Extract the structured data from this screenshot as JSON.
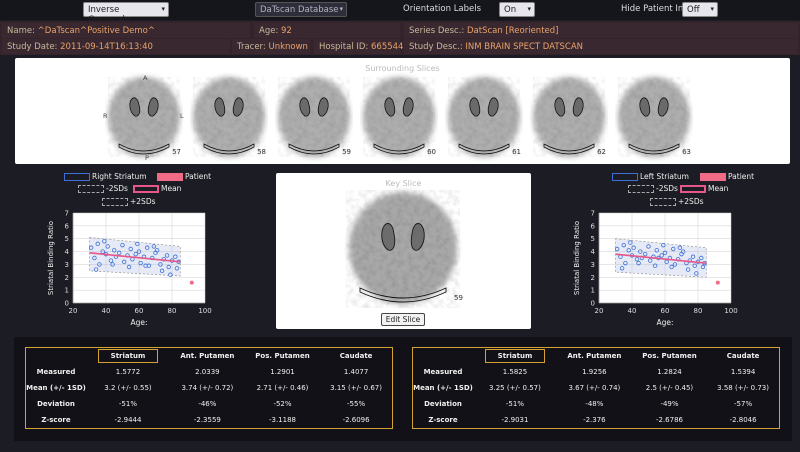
{
  "toolbar": {
    "colormap": "Inverse Greyscale",
    "database": "DaTscan Database",
    "orientation_label": "Orientation Labels",
    "orientation_value": "On",
    "hide_label": "Hide Patient Info",
    "hide_value": "Off"
  },
  "patient": {
    "name_k": "Name:",
    "name_v": "^DaTscan^Positive Demo^",
    "age_k": "Age:",
    "age_v": "92",
    "series_k": "Series Desc.:",
    "series_v": "DatScan [Reoriented]",
    "date_k": "Study Date:",
    "date_v": "2011-09-14T16:13:40",
    "tracer_k": "Tracer:",
    "tracer_v": "Unknown",
    "hosp_k": "Hospital ID:",
    "hosp_v": "665544",
    "study_k": "Study Desc.:",
    "study_v": "INM BRAIN SPECT DATSCAN"
  },
  "surrounding": {
    "title": "Surrounding Slices",
    "labels": {
      "a": "A",
      "r": "R",
      "l": "L",
      "p": "P"
    },
    "slices": [
      "57",
      "58",
      "59",
      "60",
      "61",
      "62",
      "63"
    ]
  },
  "key": {
    "title": "Key Slice",
    "slice": "59",
    "button": "Edit Slice"
  },
  "legend": {
    "right": "Right Striatum",
    "left": "Left Striatum",
    "patient": "Patient",
    "minus": "-2SDs",
    "mean": "Mean",
    "plus": "+2SDs"
  },
  "colors": {
    "patient": "#f26b86",
    "mean": "#e8578a",
    "normal": "#3d6fd6",
    "accent": "#d4a334"
  },
  "chart_data": [
    {
      "type": "scatter",
      "title": "",
      "xlabel": "Age:",
      "ylabel": "Striatal Binding Ratio",
      "xlim": [
        20,
        100
      ],
      "ylim": [
        0,
        7
      ],
      "xticks": [
        "20",
        "40",
        "60",
        "80",
        "100"
      ],
      "yticks": [
        "0",
        "1",
        "2",
        "3",
        "4",
        "5",
        "6",
        "7"
      ],
      "series": [
        {
          "name": "Right Striatum",
          "x": [
            31,
            33,
            35,
            36,
            38,
            40,
            41,
            43,
            45,
            46,
            48,
            50,
            51,
            53,
            55,
            56,
            58,
            60,
            61,
            63,
            65,
            66,
            68,
            70,
            71,
            73,
            75,
            77,
            78,
            80,
            82,
            83,
            84,
            34,
            44,
            54,
            64,
            74,
            39,
            59,
            69,
            79
          ],
          "y": [
            4.3,
            3.5,
            4.6,
            3.0,
            4.0,
            3.8,
            4.4,
            3.3,
            4.1,
            3.6,
            3.9,
            4.5,
            3.2,
            3.7,
            4.2,
            3.4,
            3.8,
            4.0,
            3.1,
            3.6,
            4.3,
            2.9,
            3.5,
            3.9,
            4.1,
            3.0,
            3.4,
            3.7,
            2.8,
            3.3,
            3.6,
            2.7,
            3.2,
            2.6,
            3.0,
            2.8,
            2.9,
            2.5,
            4.8,
            4.6,
            4.4,
            2.2
          ]
        },
        {
          "name": "Patient",
          "x": [
            92
          ],
          "y": [
            1.58
          ]
        }
      ],
      "mean_line": {
        "x": [
          30,
          85
        ],
        "y": [
          3.9,
          3.2
        ]
      },
      "band_lower": {
        "x": [
          30,
          85
        ],
        "y": [
          2.5,
          2.1
        ]
      },
      "band_upper": {
        "x": [
          30,
          85
        ],
        "y": [
          5.1,
          4.4
        ]
      }
    },
    {
      "type": "scatter",
      "title": "",
      "xlabel": "Age:",
      "ylabel": "Striatal Binding Ratio",
      "xlim": [
        20,
        100
      ],
      "ylim": [
        0,
        7
      ],
      "xticks": [
        "20",
        "40",
        "60",
        "80",
        "100"
      ],
      "yticks": [
        "0",
        "1",
        "2",
        "3",
        "4",
        "5",
        "6",
        "7"
      ],
      "series": [
        {
          "name": "Left Striatum",
          "x": [
            31,
            33,
            35,
            36,
            38,
            40,
            41,
            43,
            45,
            46,
            48,
            50,
            51,
            53,
            55,
            56,
            58,
            60,
            61,
            63,
            65,
            66,
            68,
            70,
            71,
            73,
            75,
            77,
            78,
            80,
            82,
            83,
            84,
            34,
            44,
            54,
            64,
            74,
            39,
            59,
            69,
            79
          ],
          "y": [
            4.2,
            3.6,
            4.5,
            3.1,
            4.1,
            3.7,
            4.3,
            3.4,
            4.0,
            3.5,
            3.8,
            4.4,
            3.3,
            3.6,
            4.1,
            3.5,
            3.7,
            3.9,
            3.2,
            3.5,
            4.2,
            3.0,
            3.4,
            3.8,
            4.0,
            3.1,
            3.3,
            3.6,
            2.9,
            3.2,
            3.5,
            2.8,
            3.1,
            2.7,
            3.1,
            2.9,
            2.8,
            2.6,
            4.7,
            4.5,
            4.3,
            2.3
          ]
        },
        {
          "name": "Patient",
          "x": [
            92
          ],
          "y": [
            1.58
          ]
        }
      ],
      "mean_line": {
        "x": [
          30,
          85
        ],
        "y": [
          3.8,
          3.1
        ]
      },
      "band_lower": {
        "x": [
          30,
          85
        ],
        "y": [
          2.4,
          2.0
        ]
      },
      "band_upper": {
        "x": [
          30,
          85
        ],
        "y": [
          5.0,
          4.3
        ]
      }
    }
  ],
  "tables": [
    {
      "headers": [
        "",
        "Striatum",
        "Ant. Putamen",
        "Pos. Putamen",
        "Caudate"
      ],
      "rows": [
        [
          "Measured",
          "1.5772",
          "2.0339",
          "1.2901",
          "1.4077"
        ],
        [
          "Mean (+/- 1SD)",
          "3.2 (+/- 0.55)",
          "3.74 (+/- 0.72)",
          "2.71 (+/- 0.46)",
          "3.15 (+/- 0.67)"
        ],
        [
          "Deviation",
          "-51%",
          "-46%",
          "-52%",
          "-55%"
        ],
        [
          "Z-score",
          "-2.9444",
          "-2.3559",
          "-3.1188",
          "-2.6096"
        ]
      ]
    },
    {
      "headers": [
        "",
        "Striatum",
        "Ant. Putamen",
        "Pos. Putamen",
        "Caudate"
      ],
      "rows": [
        [
          "Measured",
          "1.5825",
          "1.9256",
          "1.2824",
          "1.5394"
        ],
        [
          "Mean (+/- 1SD)",
          "3.25 (+/- 0.57)",
          "3.67 (+/- 0.74)",
          "2.5 (+/- 0.45)",
          "3.58 (+/- 0.73)"
        ],
        [
          "Deviation",
          "-51%",
          "-48%",
          "-49%",
          "-57%"
        ],
        [
          "Z-score",
          "-2.9031",
          "-2.376",
          "-2.6786",
          "-2.8046"
        ]
      ]
    }
  ]
}
